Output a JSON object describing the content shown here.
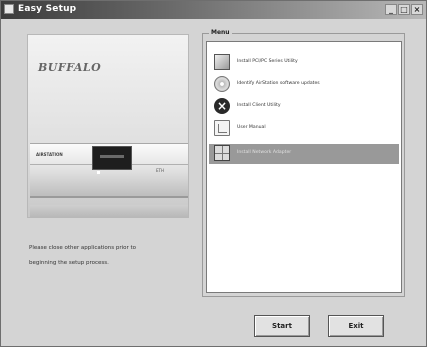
{
  "window": {
    "title": "Easy Setup",
    "minimize_glyph": "_",
    "maximize_glyph": "□",
    "close_glyph": "×"
  },
  "brand": {
    "logo_text": "BUFFALO"
  },
  "device": {
    "front_label": "AIRSTATION",
    "tag": "ETH"
  },
  "hint": {
    "line1": "Please close other applications prior to",
    "line2": "beginning the setup process."
  },
  "menu": {
    "group_label": "Menu",
    "items": [
      {
        "label": "Install PCI/PC Series Utility",
        "icon": "installer-box-icon"
      },
      {
        "label": "Identify AirStation software updates",
        "icon": "cd-disc-icon"
      },
      {
        "label": "Install Client Utility",
        "icon": "x-install-icon"
      },
      {
        "label": "User Manual",
        "icon": "manual-book-icon"
      },
      {
        "label": "Install Network Adapter",
        "icon": "network-adapter-icon"
      }
    ],
    "selected_index": 4
  },
  "buttons": {
    "start_label": "Start",
    "exit_label": "Exit"
  }
}
